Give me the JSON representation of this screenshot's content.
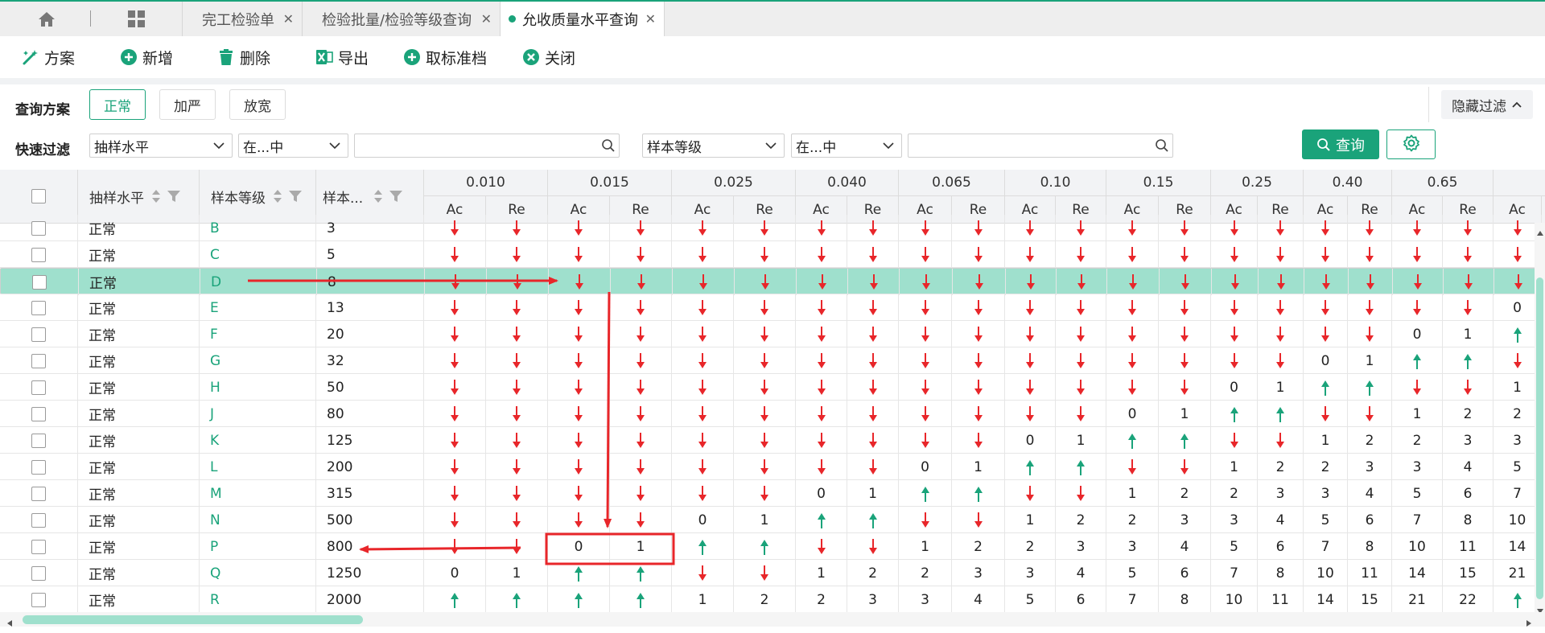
{
  "tabs": [
    {
      "label": "完工检验单",
      "active": false
    },
    {
      "label": "检验批量/检验等级查询",
      "active": false
    },
    {
      "label": "允收质量水平查询",
      "active": true
    }
  ],
  "toolbar": {
    "scheme": "方案",
    "add": "新增",
    "delete": "删除",
    "export": "导出",
    "unstandard": "取标准档",
    "close": "关闭"
  },
  "query": {
    "plan_label": "查询方案",
    "plans": [
      "正常",
      "加严",
      "放宽"
    ],
    "active_plan": "正常",
    "filter_label": "快速过滤",
    "filter1": {
      "field": "抽样水平",
      "op": "在...中",
      "value": ""
    },
    "filter2": {
      "field": "样本等级",
      "op": "在...中",
      "value": ""
    },
    "query_btn": "查询",
    "hide_filter": "隐藏过滤"
  },
  "colors": {
    "accent": "#1aa37a",
    "arrow_down": "#e8262a",
    "arrow_up": "#1aa37a",
    "selected_row": "#9fe0cd"
  },
  "table": {
    "col_sampling": "抽样水平",
    "col_grade": "样本等级",
    "col_size": "样本...",
    "aql": [
      "0.010",
      "0.015",
      "0.025",
      "0.040",
      "0.065",
      "0.10",
      "0.15",
      "0.25",
      "0.40",
      "0.65",
      ""
    ],
    "ac": "Ac",
    "re": "Re",
    "rows": [
      {
        "level": "正常",
        "grade": "B",
        "size": "3",
        "v": [
          "d",
          "d",
          "d",
          "d",
          "d",
          "d",
          "d",
          "d",
          "d",
          "d",
          "d",
          "d",
          "d",
          "d",
          "d",
          "d",
          "d",
          "d",
          "d",
          "d",
          "d"
        ]
      },
      {
        "level": "正常",
        "grade": "C",
        "size": "5",
        "v": [
          "d",
          "d",
          "d",
          "d",
          "d",
          "d",
          "d",
          "d",
          "d",
          "d",
          "d",
          "d",
          "d",
          "d",
          "d",
          "d",
          "d",
          "d",
          "d",
          "d",
          "d"
        ]
      },
      {
        "level": "正常",
        "grade": "D",
        "size": "8",
        "selected": true,
        "v": [
          "d",
          "d",
          "d",
          "d",
          "d",
          "d",
          "d",
          "d",
          "d",
          "d",
          "d",
          "d",
          "d",
          "d",
          "d",
          "d",
          "d",
          "d",
          "d",
          "d",
          "d"
        ]
      },
      {
        "level": "正常",
        "grade": "E",
        "size": "13",
        "v": [
          "d",
          "d",
          "d",
          "d",
          "d",
          "d",
          "d",
          "d",
          "d",
          "d",
          "d",
          "d",
          "d",
          "d",
          "d",
          "d",
          "d",
          "d",
          "d",
          "d",
          "0"
        ]
      },
      {
        "level": "正常",
        "grade": "F",
        "size": "20",
        "v": [
          "d",
          "d",
          "d",
          "d",
          "d",
          "d",
          "d",
          "d",
          "d",
          "d",
          "d",
          "d",
          "d",
          "d",
          "d",
          "d",
          "d",
          "d",
          "0",
          "1",
          "u"
        ]
      },
      {
        "level": "正常",
        "grade": "G",
        "size": "32",
        "v": [
          "d",
          "d",
          "d",
          "d",
          "d",
          "d",
          "d",
          "d",
          "d",
          "d",
          "d",
          "d",
          "d",
          "d",
          "d",
          "d",
          "0",
          "1",
          "u",
          "u",
          "d"
        ]
      },
      {
        "level": "正常",
        "grade": "H",
        "size": "50",
        "v": [
          "d",
          "d",
          "d",
          "d",
          "d",
          "d",
          "d",
          "d",
          "d",
          "d",
          "d",
          "d",
          "d",
          "d",
          "0",
          "1",
          "u",
          "u",
          "d",
          "d",
          "1"
        ]
      },
      {
        "level": "正常",
        "grade": "J",
        "size": "80",
        "v": [
          "d",
          "d",
          "d",
          "d",
          "d",
          "d",
          "d",
          "d",
          "d",
          "d",
          "d",
          "d",
          "0",
          "1",
          "u",
          "u",
          "d",
          "d",
          "1",
          "2",
          "2"
        ]
      },
      {
        "level": "正常",
        "grade": "K",
        "size": "125",
        "v": [
          "d",
          "d",
          "d",
          "d",
          "d",
          "d",
          "d",
          "d",
          "d",
          "d",
          "0",
          "1",
          "u",
          "u",
          "d",
          "d",
          "1",
          "2",
          "2",
          "3",
          "3"
        ]
      },
      {
        "level": "正常",
        "grade": "L",
        "size": "200",
        "v": [
          "d",
          "d",
          "d",
          "d",
          "d",
          "d",
          "d",
          "d",
          "0",
          "1",
          "u",
          "u",
          "d",
          "d",
          "1",
          "2",
          "2",
          "3",
          "3",
          "4",
          "5"
        ]
      },
      {
        "level": "正常",
        "grade": "M",
        "size": "315",
        "v": [
          "d",
          "d",
          "d",
          "d",
          "d",
          "d",
          "0",
          "1",
          "u",
          "u",
          "d",
          "d",
          "1",
          "2",
          "2",
          "3",
          "3",
          "4",
          "5",
          "6",
          "7"
        ]
      },
      {
        "level": "正常",
        "grade": "N",
        "size": "500",
        "v": [
          "d",
          "d",
          "d",
          "d",
          "0",
          "1",
          "u",
          "u",
          "d",
          "d",
          "1",
          "2",
          "2",
          "3",
          "3",
          "4",
          "5",
          "6",
          "7",
          "8",
          "10"
        ]
      },
      {
        "level": "正常",
        "grade": "P",
        "size": "800",
        "v": [
          "d",
          "d",
          "0",
          "1",
          "u",
          "u",
          "d",
          "d",
          "1",
          "2",
          "2",
          "3",
          "3",
          "4",
          "5",
          "6",
          "7",
          "8",
          "10",
          "11",
          "14"
        ]
      },
      {
        "level": "正常",
        "grade": "Q",
        "size": "1250",
        "v": [
          "0",
          "1",
          "u",
          "u",
          "d",
          "d",
          "1",
          "2",
          "2",
          "3",
          "3",
          "4",
          "5",
          "6",
          "7",
          "8",
          "10",
          "11",
          "14",
          "15",
          "21"
        ]
      },
      {
        "level": "正常",
        "grade": "R",
        "size": "2000",
        "v": [
          "u",
          "u",
          "u",
          "u",
          "1",
          "2",
          "2",
          "3",
          "3",
          "4",
          "5",
          "6",
          "7",
          "8",
          "10",
          "11",
          "14",
          "15",
          "21",
          "22",
          "u"
        ]
      }
    ]
  }
}
